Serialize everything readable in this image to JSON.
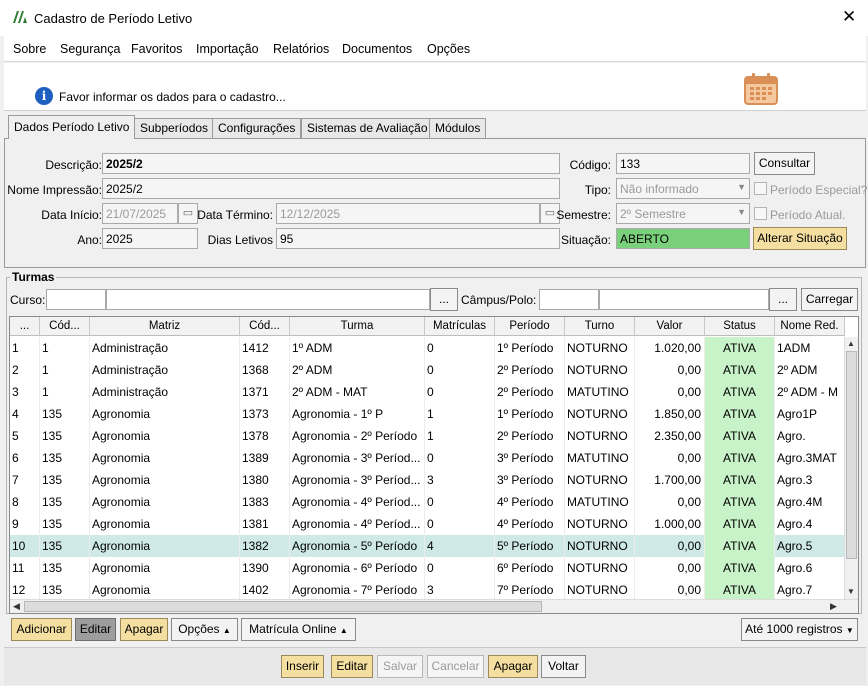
{
  "window": {
    "title": "Cadastro de Período Letivo"
  },
  "menu": [
    "Sobre",
    "Segurança",
    "Favoritos",
    "Importação",
    "Relatórios",
    "Documentos",
    "Opções"
  ],
  "info": {
    "message": "Favor informar os dados para o cadastro..."
  },
  "tabs": [
    "Dados Período Letivo",
    "Subperíodos",
    "Configurações",
    "Sistemas de Avaliação",
    "Módulos"
  ],
  "form": {
    "descricao_label": "Descrição:",
    "descricao": "2025/2",
    "nome_impressao_label": "Nome Impressão:",
    "nome_impressao": "2025/2",
    "data_inicio_label": "Data Início:",
    "data_inicio": "21/07/2025",
    "data_termino_label": "Data Término:",
    "data_termino": "12/12/2025",
    "ano_label": "Ano:",
    "ano": "2025",
    "dias_letivos_label": "Dias Letivos",
    "dias_letivos": "95",
    "codigo_label": "Código:",
    "codigo": "133",
    "consultar": "Consultar",
    "tipo_label": "Tipo:",
    "tipo": "Não informado",
    "periodo_especial": "Período Especial?",
    "semestre_label": "Semestre:",
    "semestre": "2º Semestre",
    "periodo_atual": "Período Atual.",
    "situacao_label": "Situação:",
    "situacao": "ABERTO",
    "alterar_situacao": "Alterar Situação"
  },
  "turmas": {
    "title": "Turmas",
    "curso_label": "Curso:",
    "campus_label": "Câmpus/Polo:",
    "ellipsis": "...",
    "carregar": "Carregar",
    "columns": [
      "...",
      "Cód...",
      "Matriz",
      "Cód...",
      "Turma",
      "Matrículas",
      "Período",
      "Turno",
      "Valor",
      "Status",
      "Nome Red."
    ],
    "rows": [
      [
        "1",
        "1",
        "Administração",
        "1412",
        "1º ADM",
        "0",
        "1º Período",
        "NOTURNO",
        "1.020,00",
        "ATIVA",
        "1ADM"
      ],
      [
        "2",
        "1",
        "Administração",
        "1368",
        "2º ADM",
        "0",
        "2º Período",
        "NOTURNO",
        "0,00",
        "ATIVA",
        "2º ADM"
      ],
      [
        "3",
        "1",
        "Administração",
        "1371",
        "2º ADM - MAT",
        "0",
        "2º Período",
        "MATUTINO",
        "0,00",
        "ATIVA",
        "2º ADM - M"
      ],
      [
        "4",
        "135",
        "Agronomia",
        "1373",
        "Agronomia - 1º P",
        "1",
        "1º Período",
        "NOTURNO",
        "1.850,00",
        "ATIVA",
        "Agro1P"
      ],
      [
        "5",
        "135",
        "Agronomia",
        "1378",
        "Agronomia - 2º Período",
        "1",
        "2º Período",
        "NOTURNO",
        "2.350,00",
        "ATIVA",
        "Agro."
      ],
      [
        "6",
        "135",
        "Agronomia",
        "1389",
        "Agronomia - 3º Períod...",
        "0",
        "3º Período",
        "MATUTINO",
        "0,00",
        "ATIVA",
        "Agro.3MAT"
      ],
      [
        "7",
        "135",
        "Agronomia",
        "1380",
        "Agronomia - 3º Períod...",
        "3",
        "3º Período",
        "NOTURNO",
        "1.700,00",
        "ATIVA",
        "Agro.3"
      ],
      [
        "8",
        "135",
        "Agronomia",
        "1383",
        "Agronomia - 4º Períod...",
        "0",
        "4º Período",
        "MATUTINO",
        "0,00",
        "ATIVA",
        "Agro.4M"
      ],
      [
        "9",
        "135",
        "Agronomia",
        "1381",
        "Agronomia - 4º Períod...",
        "0",
        "4º Período",
        "NOTURNO",
        "1.000,00",
        "ATIVA",
        "Agro.4"
      ],
      [
        "10",
        "135",
        "Agronomia",
        "1382",
        "Agronomia - 5º Período",
        "4",
        "5º Período",
        "NOTURNO",
        "0,00",
        "ATIVA",
        "Agro.5"
      ],
      [
        "11",
        "135",
        "Agronomia",
        "1390",
        "Agronomia - 6º Período",
        "0",
        "6º Período",
        "NOTURNO",
        "0,00",
        "ATIVA",
        "Agro.6"
      ],
      [
        "12",
        "135",
        "Agronomia",
        "1402",
        "Agronomia - 7º Período",
        "3",
        "7º Período",
        "NOTURNO",
        "0,00",
        "ATIVA",
        "Agro.7"
      ]
    ],
    "selected_row": 10
  },
  "grid_buttons": {
    "adicionar": "Adicionar",
    "editar": "Editar",
    "apagar": "Apagar",
    "opcoes": "Opções",
    "matricula_online": "Matrícula Online",
    "limite": "Até 1000 registros"
  },
  "footer": {
    "inserir": "Inserir",
    "editar": "Editar",
    "salvar": "Salvar",
    "cancelar": "Cancelar",
    "apagar": "Apagar",
    "voltar": "Voltar"
  },
  "colors": {
    "status_bg": "#c8f2c8",
    "selected_row": "#cfe9e6",
    "situacao_bg": "#7bd17b",
    "button_yellow": "#f4dfa0"
  }
}
